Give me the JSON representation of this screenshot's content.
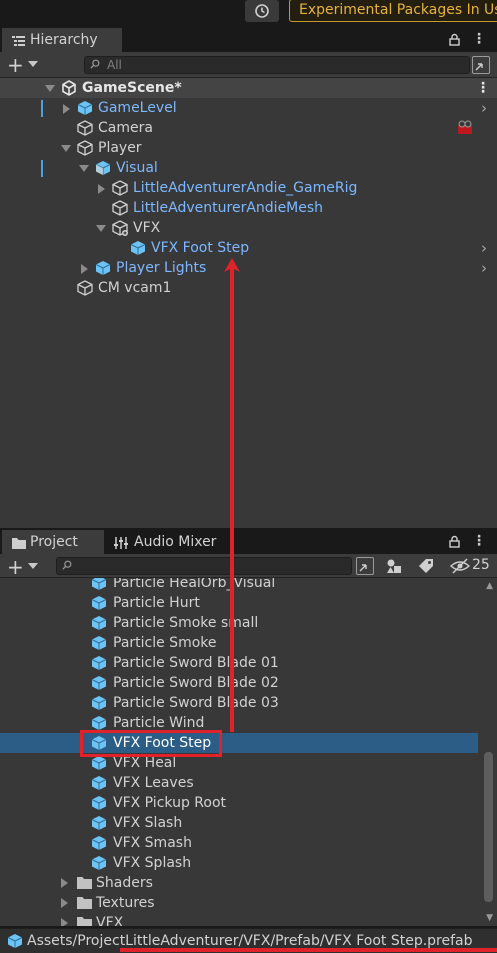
{
  "toolbar": {
    "history_icon": "history-icon",
    "experimental_label": "Experimental Packages In Us"
  },
  "hierarchy": {
    "tab_label": "Hierarchy",
    "search_placeholder": "All",
    "scene_name": "GameScene*",
    "items": [
      {
        "label": "GameLevel",
        "color": "#7db8ff",
        "icon": "prefab-cube-icon"
      },
      {
        "label": "Camera",
        "color": "#d2d2d2",
        "icon": "gameobject-cube-icon"
      },
      {
        "label": "Player",
        "color": "#d2d2d2",
        "icon": "gameobject-cube-icon"
      },
      {
        "label": "Visual",
        "color": "#7db8ff",
        "icon": "prefab-variant-cube-icon"
      },
      {
        "label": "LittleAdventurerAndie_GameRig",
        "color": "#7db8ff",
        "icon": "gameobject-cube-icon"
      },
      {
        "label": "LittleAdventurerAndieMesh",
        "color": "#7db8ff",
        "icon": "gameobject-cube-icon"
      },
      {
        "label": "VFX",
        "color": "#d2d2d2",
        "icon": "gameobject-added-cube-icon"
      },
      {
        "label": "VFX Foot Step",
        "color": "#7db8ff",
        "icon": "prefab-cube-icon"
      },
      {
        "label": "Player Lights",
        "color": "#7db8ff",
        "icon": "prefab-cube-icon"
      },
      {
        "label": "CM vcam1",
        "color": "#d2d2d2",
        "icon": "gameobject-cube-icon"
      }
    ]
  },
  "project": {
    "tab_label": "Project",
    "audio_tab_label": "Audio Mixer",
    "hidden_count": "25",
    "assets": [
      "Particle HealOrb_Visual",
      "Particle Hurt",
      "Particle Smoke small",
      "Particle Smoke",
      "Particle Sword Blade 01",
      "Particle Sword Blade 02",
      "Particle Sword Blade 03",
      "Particle Wind",
      "VFX Foot Step",
      "VFX Heal",
      "VFX Leaves",
      "VFX Pickup Root",
      "VFX Slash",
      "VFX Smash",
      "VFX Splash"
    ],
    "selected_asset": "VFX Foot Step",
    "folders": [
      "Shaders",
      "Textures",
      "VFX"
    ],
    "status_path": "Assets/ProjectLittleAdventurer/VFX/Prefab/VFX Foot Step.prefab"
  },
  "colors": {
    "accent_blue": "#7db8ff",
    "selection": "#2c5d87",
    "annotation_red": "#e0232b",
    "prefab_icon": "#6cc3f5"
  }
}
